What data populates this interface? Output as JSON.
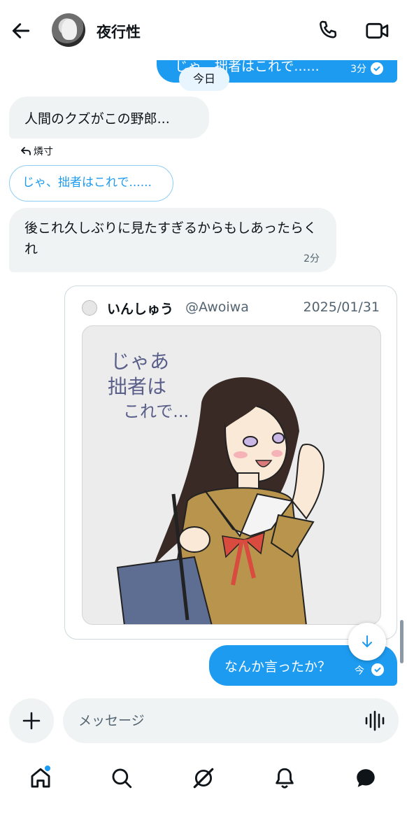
{
  "header": {
    "contact_name": "夜行性"
  },
  "conversation": {
    "previous_outgoing": {
      "text": "じゃ、拙者はこれで......",
      "time": "3分"
    },
    "date_separator": "今日",
    "incoming_1": {
      "text": "人間のクズがこの野郎..."
    },
    "reply_to_author": "燐寸",
    "reply_quote": "じゃ、拙者はこれで......",
    "incoming_2": {
      "text": "後これ久しぶりに見たすぎるからもしあったらくれ",
      "time": "2分"
    },
    "shared_post": {
      "author": "いんしゅう",
      "handle": "@Awoiwa",
      "date": "2025/01/31",
      "image_handwriting": [
        "じゃあ",
        "拙者は",
        "これで..."
      ]
    },
    "outgoing_latest": {
      "text": "なんか言ったか？",
      "time": "今"
    }
  },
  "composer": {
    "placeholder": "メッセージ"
  },
  "icons": {
    "back": "back-arrow-icon",
    "call": "phone-icon",
    "video": "video-camera-icon",
    "add": "plus-icon",
    "voice": "voice-wave-icon",
    "scroll_down": "arrow-down-icon",
    "nav": [
      "home-icon",
      "search-icon",
      "grok-icon",
      "bell-icon",
      "messages-icon"
    ]
  },
  "colors": {
    "accent": "#1d9bf0",
    "incoming_bubble": "#eff3f4",
    "text_primary": "#0f1419",
    "text_secondary": "#536471"
  }
}
